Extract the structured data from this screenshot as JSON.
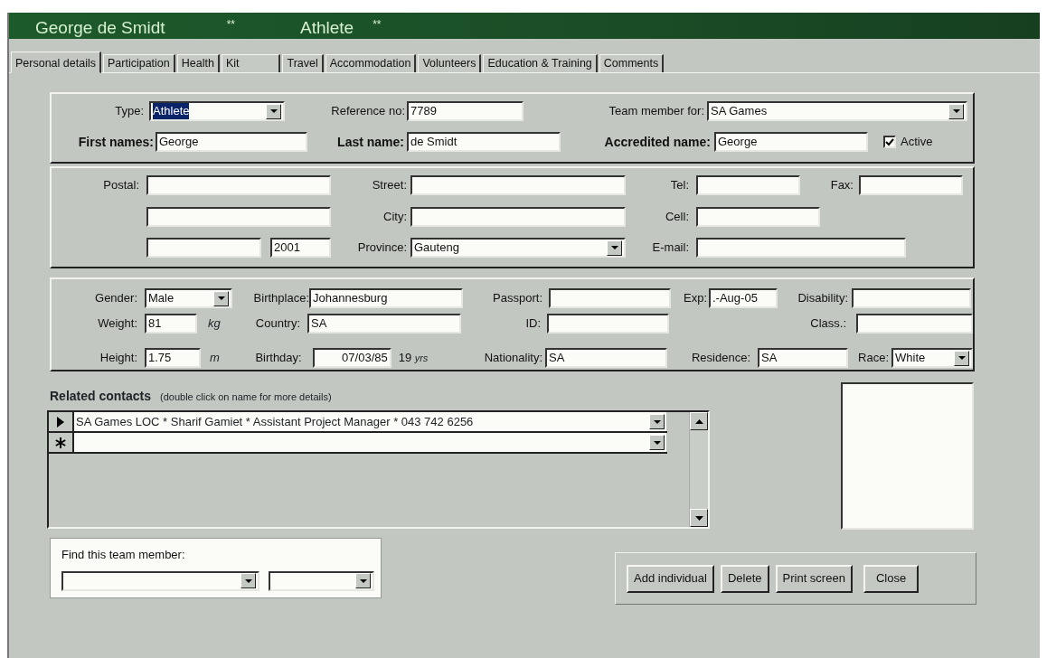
{
  "header": {
    "name": "George de Smidt",
    "name_marker": "**",
    "role": "Athlete",
    "role_marker": "**"
  },
  "tabs": [
    {
      "label": "Personal details",
      "selected": true
    },
    {
      "label": "Participation",
      "selected": false
    },
    {
      "label": "Health",
      "selected": false
    },
    {
      "label": "Kit",
      "selected": false
    },
    {
      "label": "Travel",
      "selected": false
    },
    {
      "label": "Accommodation",
      "selected": false
    },
    {
      "label": "Volunteers",
      "selected": false
    },
    {
      "label": "Education & Training",
      "selected": false
    },
    {
      "label": "Comments",
      "selected": false
    }
  ],
  "identity": {
    "type": {
      "label": "Type:",
      "value": "Athlete",
      "highlighted": true
    },
    "reference": {
      "label": "Reference no:",
      "value": "7789"
    },
    "team": {
      "label": "Team member for:",
      "value": "SA Games"
    },
    "first_names": {
      "label": "First names:",
      "value": "George"
    },
    "last_name": {
      "label": "Last name:",
      "value": "de Smidt"
    },
    "accredited_name": {
      "label": "Accredited name:",
      "value": "George"
    },
    "active": {
      "label": "Active",
      "checked": true
    }
  },
  "contact": {
    "postal": {
      "label": "Postal:"
    },
    "street": {
      "label": "Street:"
    },
    "tel": {
      "label": "Tel:"
    },
    "fax": {
      "label": "Fax:"
    },
    "city": {
      "label": "City:"
    },
    "cell": {
      "label": "Cell:"
    },
    "postal_code": {
      "value": "2001"
    },
    "province": {
      "label": "Province:",
      "value": "Gauteng"
    },
    "email": {
      "label": "E-mail:"
    }
  },
  "profile": {
    "gender": {
      "label": "Gender:",
      "value": "Male"
    },
    "birthplace": {
      "label": "Birthplace:",
      "value": "Johannesburg"
    },
    "passport": {
      "label": "Passport:"
    },
    "exp": {
      "label": "Exp:",
      "value": ".-Aug-05"
    },
    "disability": {
      "label": "Disability:"
    },
    "weight": {
      "label": "Weight:",
      "value": "81",
      "unit": "kg"
    },
    "country": {
      "label": "Country:",
      "value": "SA"
    },
    "id": {
      "label": "ID:"
    },
    "class": {
      "label": "Class.:"
    },
    "height": {
      "label": "Height:",
      "value": "1.75",
      "unit": "m"
    },
    "birthday": {
      "label": "Birthday:",
      "value": "07/03/85"
    },
    "age": {
      "value": "19",
      "unit": "yrs"
    },
    "nationality": {
      "label": "Nationality:",
      "value": "SA"
    },
    "residence": {
      "label": "Residence:",
      "value": "SA"
    },
    "race": {
      "label": "Race:",
      "value": "White"
    }
  },
  "related_contacts": {
    "title": "Related contacts",
    "hint": "(double click on name for more details)",
    "rows": [
      {
        "kind": "current",
        "text": "SA Games LOC * Sharif Gamiet * Assistant Project Manager * 043 742 6256"
      },
      {
        "kind": "new"
      }
    ]
  },
  "find": {
    "label": "Find this team member:"
  },
  "buttons": [
    "Add individual",
    "Delete",
    "Print screen",
    "Close"
  ]
}
